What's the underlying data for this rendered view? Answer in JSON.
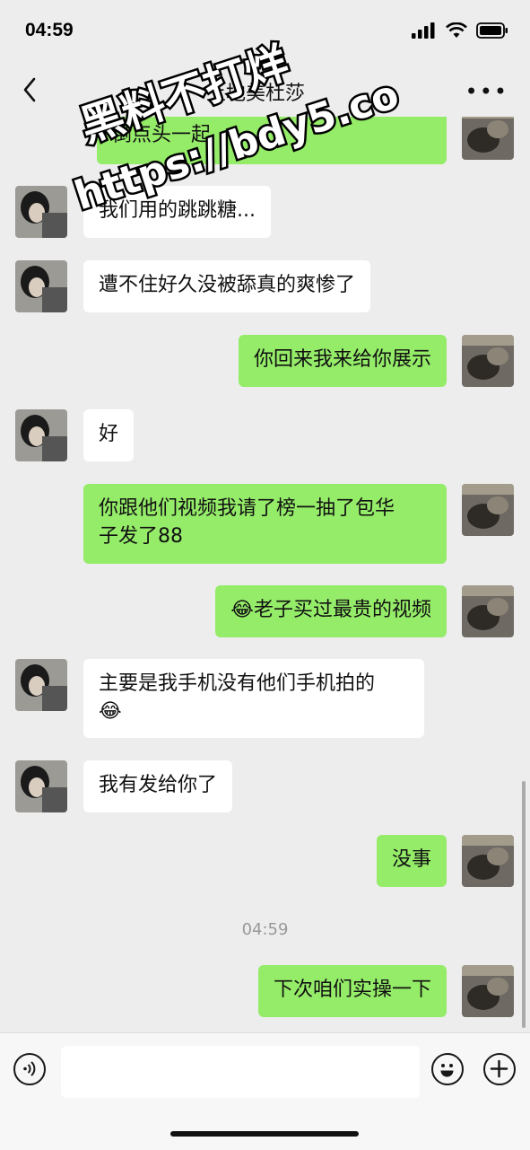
{
  "status": {
    "time": "04:59"
  },
  "nav": {
    "title": "土地美杜莎",
    "more": "•••"
  },
  "messages": [
    {
      "side": "right",
      "text": "倒点头一起",
      "top": 0
    },
    {
      "side": "left",
      "text": "我们用的跳跳糖..."
    },
    {
      "side": "left",
      "text": "遭不住好久没被舔真的爽惨了"
    },
    {
      "side": "right",
      "text": "你回来我来给你展示"
    },
    {
      "side": "left",
      "text": "好"
    },
    {
      "side": "right",
      "text": "你跟他们视频我请了榜一抽了包华\n子发了88"
    },
    {
      "side": "right",
      "text": "😂老子买过最贵的视频"
    },
    {
      "side": "left",
      "text": "主要是我手机没有他们手机拍的\n😂"
    },
    {
      "side": "left",
      "text": "我有发给你了"
    },
    {
      "side": "right",
      "text": "没事"
    },
    {
      "side": "right",
      "text": "下次咱们实操一下"
    }
  ],
  "timestamp": "04:59",
  "watermark": {
    "line1": "黑料不打烊",
    "line2": "https://bdy5.co"
  },
  "icons": {
    "back": "chevron-left-icon",
    "voice": "voice-icon",
    "emoji": "emoji-icon",
    "plus": "plus-icon"
  }
}
